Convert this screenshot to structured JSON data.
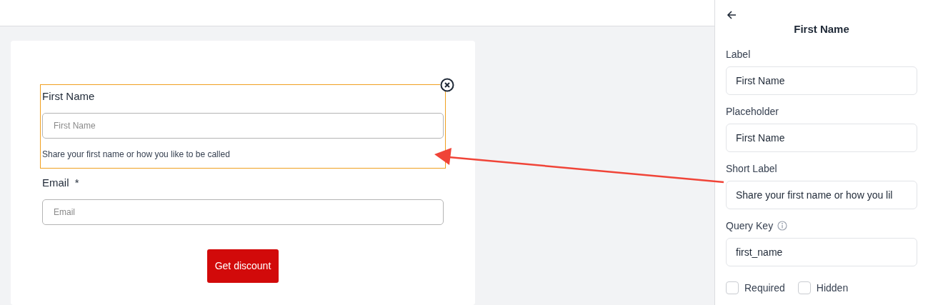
{
  "form": {
    "fields": [
      {
        "label": "First Name",
        "selected": true,
        "placeholder": "First Name",
        "help": "Share your first name or how you like to be called"
      },
      {
        "label": "Email",
        "required_mark": "*",
        "selected": false,
        "placeholder": "Email"
      }
    ],
    "submit": "Get discount"
  },
  "panel": {
    "title": "First Name",
    "fields": [
      {
        "label": "Label",
        "value": "First Name"
      },
      {
        "label": "Placeholder",
        "value": "First Name"
      },
      {
        "label": "Short Label",
        "value": "Share your first name or how you lil"
      },
      {
        "label": "Query Key",
        "value": "first_name",
        "info": true
      }
    ],
    "checkboxes": [
      {
        "label": "Required",
        "checked": false
      },
      {
        "label": "Hidden",
        "checked": false
      }
    ]
  }
}
